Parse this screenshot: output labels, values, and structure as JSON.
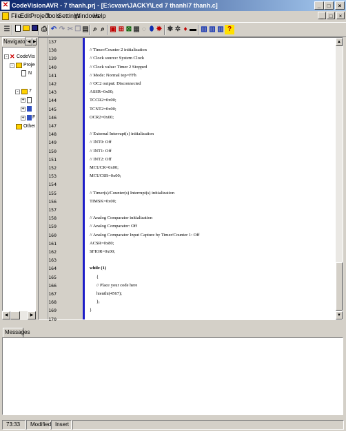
{
  "window": {
    "title": "CodeVisionAVR - 7 thanh.prj - [E:\\cvavr\\JACKY\\Led 7 thanh\\7 thanh.c]",
    "app_icon": "codevision-icon",
    "buttons": [
      "_",
      "□",
      "×"
    ]
  },
  "menu": {
    "items": [
      "File",
      "Edit",
      "Project",
      "Tools",
      "Settings",
      "Windows",
      "Help"
    ],
    "mdi_buttons": [
      "_",
      "□",
      "×"
    ]
  },
  "toolbar": {
    "icons": [
      "new-icon",
      "open-icon",
      "save-icon",
      "print-icon",
      "undo-icon",
      "redo-icon",
      "cut-icon",
      "copy-icon",
      "paste-icon",
      "find-icon",
      "replace-icon",
      "toggle-bookmark-icon",
      "compile-icon",
      "make-icon",
      "chip-icon",
      "info-icon",
      "debugger-icon",
      "stop-icon",
      "programmer-icon",
      "settings-icon",
      "wizard-icon",
      "terminal-icon",
      "tile-icon",
      "cascade-icon",
      "help-icon"
    ],
    "help_glyph": "?"
  },
  "navigator": {
    "tab_label": "Navigator",
    "tree": [
      {
        "label": "CodeVisio",
        "expand": "-",
        "icon": "codevision-icon"
      },
      {
        "label": "Project",
        "expand": "-",
        "icon": "folder-icon"
      },
      {
        "label": "N",
        "expand": "",
        "icon": "file-icon"
      },
      {
        "label": "7",
        "expand": "-",
        "icon": "folder-icon"
      },
      {
        "label": "",
        "expand": "+",
        "icon": "file-icon"
      },
      {
        "label": "",
        "expand": "+",
        "icon": "function-icon"
      },
      {
        "label": "F",
        "expand": "+",
        "icon": "function-icon"
      },
      {
        "label": "Other",
        "expand": "",
        "icon": "folder-icon"
      }
    ]
  },
  "editor": {
    "line_numbers": [
      "137",
      "138",
      "139",
      "140",
      "141",
      "142",
      "143",
      "144",
      "145",
      "146",
      "147",
      "148",
      "149",
      "150",
      "151",
      "152",
      "153",
      "154",
      "155",
      "156",
      "157",
      "158",
      "159",
      "160",
      "161",
      "162",
      "163",
      "164",
      "165",
      "166",
      "167",
      "168",
      "169",
      "170"
    ],
    "lines": [
      "",
      "// Timer/Counter 2 initialization",
      "// Clock source: System Clock",
      "// Clock value: Timer 2 Stopped",
      "// Mode: Normal top=FFh",
      "// OC2 output: Disconnected",
      "ASSR=0x00;",
      "TCCR2=0x00;",
      "TCNT2=0x00;",
      "OCR2=0x00;",
      "",
      "// External Interrupt(s) initialization",
      "// INT0: Off",
      "// INT1: Off",
      "// INT2: Off",
      "MCUCR=0x00;",
      "MCUCSR=0x00;",
      "",
      "// Timer(s)/Counter(s) Interrupt(s) initialization",
      "TIMSK=0x00;",
      "",
      "// Analog Comparator initialization",
      "// Analog Comparator: Off",
      "// Analog Comparator Input Capture by Timer/Counter 1: Off",
      "ACSR=0x80;",
      "SFIOR=0x00;",
      "",
      "while (1)",
      "      {",
      "      // Place your code here",
      "      hienthi(4567);",
      "      };",
      "}",
      ""
    ]
  },
  "messages": {
    "tab_label": "Messages"
  },
  "status": {
    "position": "73:33",
    "modified": "Modified",
    "mode": "Insert"
  }
}
